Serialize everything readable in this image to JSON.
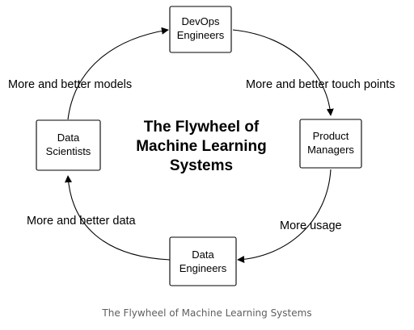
{
  "diagram": {
    "title_lines": [
      "The Flywheel of",
      "Machine Learning",
      "Systems"
    ],
    "nodes": {
      "devops": [
        "DevOps",
        "Engineers"
      ],
      "product": [
        "Product",
        "Managers"
      ],
      "data_engineers": [
        "Data",
        "Engineers"
      ],
      "data_scientists": [
        "Data",
        "Scientists"
      ]
    },
    "edges": {
      "devops_to_product": "More and better touch points",
      "product_to_data_engineers": "More usage",
      "data_engineers_to_data_scientists": "More and better data",
      "data_scientists_to_devops": "More and better models"
    }
  },
  "caption": "The Flywheel of Machine Learning Systems"
}
